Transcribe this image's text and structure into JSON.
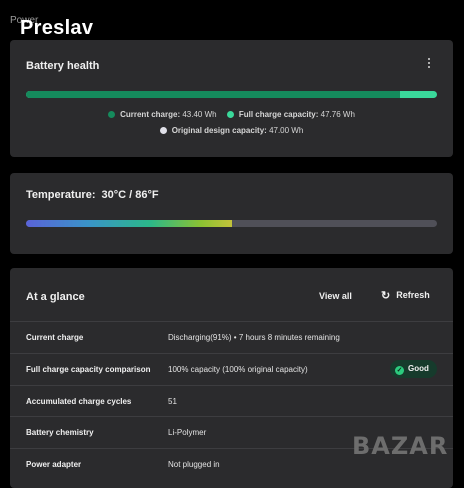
{
  "window": {
    "title": "Power"
  },
  "watermark_text": "Preslav",
  "battery_health": {
    "title": "Battery health",
    "more_icon": "more-vertical-icon",
    "current_charge_fraction": 0.909,
    "legend": [
      {
        "label": "Current charge:",
        "value": "43.40 Wh",
        "color": "#158a5c"
      },
      {
        "label": "Full charge capacity:",
        "value": "47.76 Wh",
        "color": "#3ad89a"
      },
      {
        "label": "Original design capacity:",
        "value": "47.00 Wh",
        "color": "#e0e0e8"
      }
    ]
  },
  "temperature": {
    "label": "Temperature:",
    "value": "30°C / 86°F",
    "level_fraction": 0.5
  },
  "at_a_glance": {
    "title": "At a glance",
    "view_all_label": "View all",
    "refresh_label": "Refresh",
    "refresh_icon": "refresh-icon",
    "rows": [
      {
        "label": "Current charge",
        "value": "Discharging(91%)  •  7 hours 8 minutes remaining"
      },
      {
        "label": "Full charge capacity comparison",
        "value": "100% capacity (100% original capacity)",
        "badge": "Good"
      },
      {
        "label": "Accumulated charge cycles",
        "value": "51"
      },
      {
        "label": "Battery chemistry",
        "value": "Li-Polymer"
      },
      {
        "label": "Power adapter",
        "value": "Not plugged in"
      }
    ]
  },
  "logo_text": "BAZAR",
  "colors": {
    "background": "#000000",
    "card": "#2b2b2d",
    "accent_green": "#2ccb7e"
  }
}
